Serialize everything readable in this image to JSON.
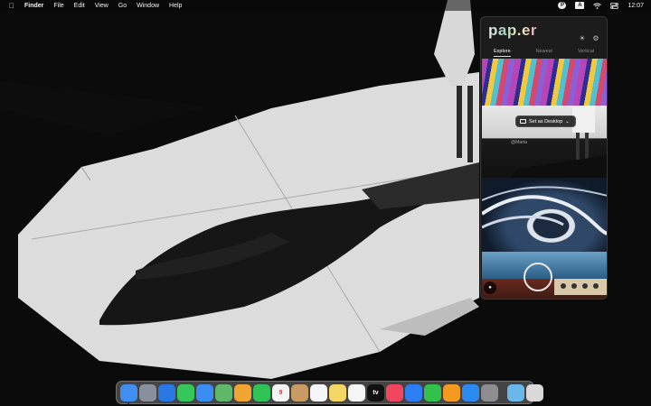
{
  "menubar": {
    "apple": "",
    "app_name": "Finder",
    "items": [
      "File",
      "Edit",
      "View",
      "Go",
      "Window",
      "Help"
    ],
    "status_icons": [
      "paper-icon",
      "input-source-icon",
      "wifi-icon",
      "control-center-icon"
    ],
    "input_source": "A",
    "time": "12:07"
  },
  "panel": {
    "logo": "pap.er",
    "tabs": [
      "Explore",
      "Newest",
      "Vertical"
    ],
    "active_tab": "Explore",
    "set_button": "Set as Desktop",
    "credit": "@Marta"
  },
  "dock": {
    "apps": [
      {
        "name": "finder-icon",
        "color": "#3f8ef0",
        "label": ""
      },
      {
        "name": "launchpad-icon",
        "color": "#8a8fa0",
        "label": ""
      },
      {
        "name": "safari-icon",
        "color": "#2a78e4",
        "label": ""
      },
      {
        "name": "messages-icon",
        "color": "#35c759",
        "label": ""
      },
      {
        "name": "mail-icon",
        "color": "#3b8cf3",
        "label": ""
      },
      {
        "name": "maps-icon",
        "color": "#5fb86a",
        "label": ""
      },
      {
        "name": "photos-icon",
        "color": "#f0a431",
        "label": ""
      },
      {
        "name": "facetime-icon",
        "color": "#2fc455",
        "label": ""
      },
      {
        "name": "calendar-icon",
        "color": "#f4f4f4",
        "label": "9"
      },
      {
        "name": "contacts-icon",
        "color": "#c99a62",
        "label": ""
      },
      {
        "name": "reminders-icon",
        "color": "#f6f6f6",
        "label": ""
      },
      {
        "name": "notes-icon",
        "color": "#f5d665",
        "label": ""
      },
      {
        "name": "freeform-icon",
        "color": "#f5f5f5",
        "label": ""
      },
      {
        "name": "tv-icon",
        "color": "#111111",
        "label": "tv"
      },
      {
        "name": "music-icon",
        "color": "#f1465c",
        "label": ""
      },
      {
        "name": "keynote-icon",
        "color": "#2d7ef4",
        "label": ""
      },
      {
        "name": "numbers-icon",
        "color": "#33c04d",
        "label": ""
      },
      {
        "name": "pages-icon",
        "color": "#f59a1e",
        "label": ""
      },
      {
        "name": "app-store-icon",
        "color": "#2a8cf0",
        "label": ""
      },
      {
        "name": "system-settings-icon",
        "color": "#8d8d92",
        "label": ""
      }
    ],
    "trailing": [
      {
        "name": "downloads-folder-icon",
        "color": "#6bb6ea",
        "label": ""
      },
      {
        "name": "trash-icon",
        "color": "#d9d9d9",
        "label": ""
      }
    ]
  }
}
